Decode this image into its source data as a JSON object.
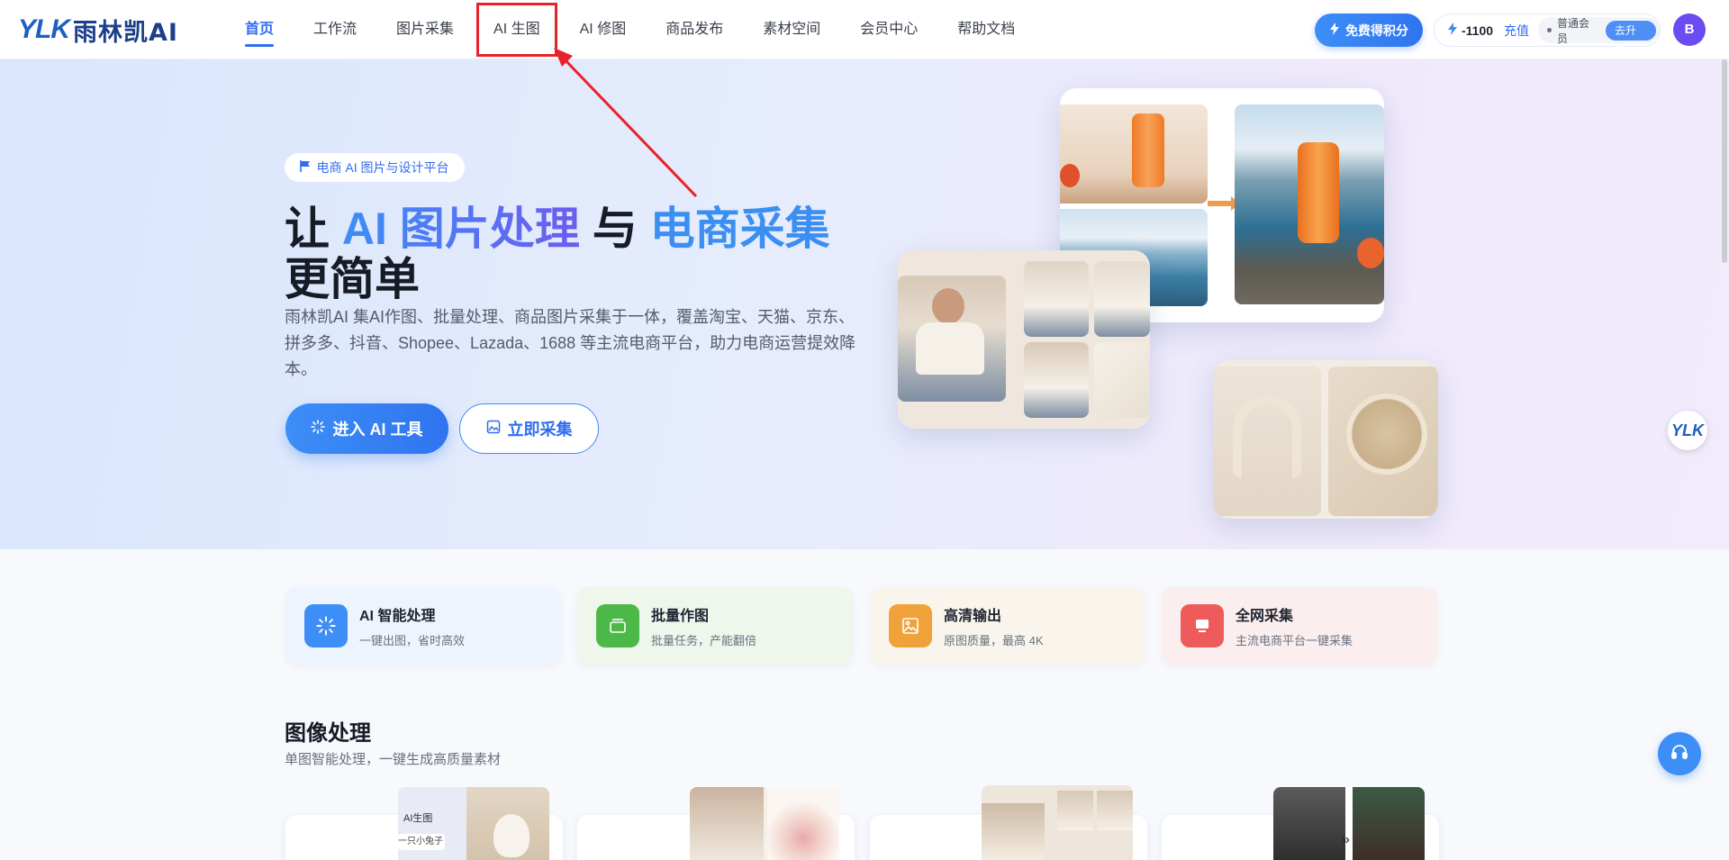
{
  "brand": {
    "logo_mark": "YLK",
    "logo_text": "雨林凯AI"
  },
  "nav": {
    "items": [
      {
        "label": "首页"
      },
      {
        "label": "工作流"
      },
      {
        "label": "图片采集"
      },
      {
        "label": "AI 生图"
      },
      {
        "label": "AI 修图"
      },
      {
        "label": "商品发布"
      },
      {
        "label": "素材空间"
      },
      {
        "label": "会员中心"
      },
      {
        "label": "帮助文档"
      }
    ],
    "active": "首页",
    "highlighted": "AI 生图"
  },
  "account": {
    "free_points_label": "免费得积分",
    "points": "-1100",
    "recharge_label": "充值",
    "member_level": "普通会员",
    "upgrade_label": "去升级",
    "avatar_letter": "B"
  },
  "hero": {
    "tag": "电商 AI 图片与设计平台",
    "title_part1": "让 ",
    "title_highlight1": "AI 图片处理",
    "title_part2": " 与 ",
    "title_highlight2": "电商采集",
    "title_line2": "更简单",
    "description": "雨林凯AI 集AI作图、批量处理、商品图片采集于一体，覆盖淘宝、天猫、京东、拼多多、抖音、Shopee、Lazada、1688 等主流电商平台，助力电商运营提效降本。",
    "primary_button": "进入 AI 工具",
    "secondary_button": "立即采集"
  },
  "features": [
    {
      "title": "AI 智能处理",
      "subtitle": "一键出图，省时高效",
      "color": "#3d8ef7",
      "bg": "#eef4fd"
    },
    {
      "title": "批量作图",
      "subtitle": "批量任务，产能翻倍",
      "color": "#4cb848",
      "bg": "#eff6ec"
    },
    {
      "title": "高清输出",
      "subtitle": "原图质量，最高 4K",
      "color": "#f0a23a",
      "bg": "#f9f5ec"
    },
    {
      "title": "全网采集",
      "subtitle": "主流电商平台一键采集",
      "color": "#ee5b5b",
      "bg": "#fbeeee"
    }
  ],
  "section": {
    "title": "图像处理",
    "subtitle": "单图智能处理，一键生成高质量素材"
  },
  "tool_previews": {
    "ai_gen_label": "AI生图",
    "ai_gen_prompt": "一只小兔子"
  },
  "colors": {
    "accent": "#2f6df0",
    "annotation": "#e8222a"
  }
}
